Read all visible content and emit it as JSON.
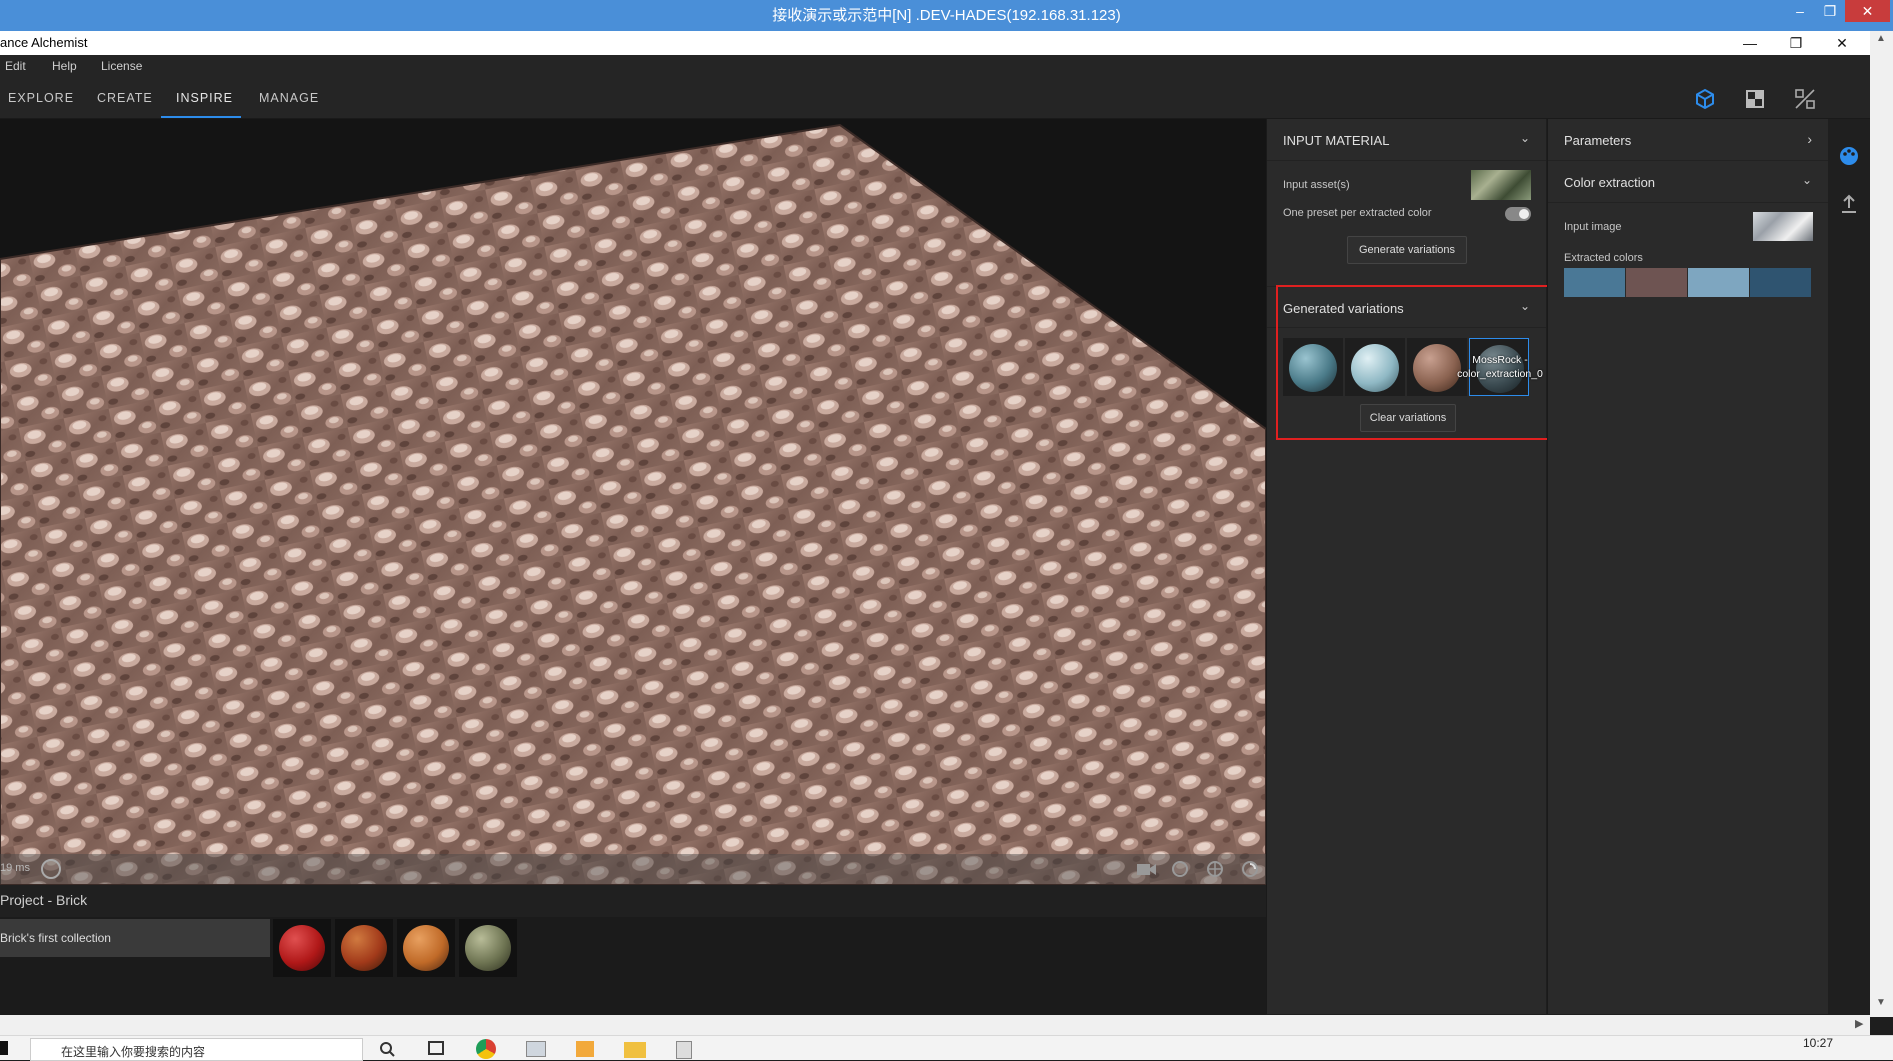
{
  "remote": {
    "title": "接收演示或示范中[N] .DEV-HADES(192.168.31.123)",
    "minimize": "–",
    "restore": "❐",
    "close": "✕"
  },
  "app": {
    "title": "ance Alchemist",
    "minimize": "—",
    "restore": "❐",
    "close": "✕"
  },
  "menu": {
    "items": [
      "Edit",
      "Help",
      "License"
    ]
  },
  "tabs": [
    {
      "label": "EXPLORE"
    },
    {
      "label": "CREATE"
    },
    {
      "label": "INSPIRE"
    },
    {
      "label": "MANAGE"
    }
  ],
  "active_tab": "INSPIRE",
  "toolbar_icons": [
    "cube-view-icon",
    "2d-view-icon",
    "split-view-icon"
  ],
  "viewport": {
    "render_time": "19 ms"
  },
  "project": {
    "title": "Project - Brick",
    "collection": "Brick's first collection",
    "materials": [
      {
        "color": "#b01818"
      },
      {
        "color": "#a23a1a"
      },
      {
        "color": "#c06a28"
      },
      {
        "color": "#6e7452"
      }
    ]
  },
  "input_material": {
    "header": "INPUT MATERIAL",
    "input_assets_label": "Input asset(s)",
    "one_preset_label": "One preset per extracted color",
    "one_preset_on": true,
    "generate_button": "Generate variations"
  },
  "generated": {
    "header": "Generated variations",
    "items": [
      {
        "color": "#4a7a88"
      },
      {
        "color": "#8fb8c4"
      },
      {
        "color": "#8a6250"
      },
      {
        "color": "#3c4c52",
        "label": "MossRock - color_extraction_0"
      }
    ],
    "clear_button": "Clear variations"
  },
  "parameters": {
    "header": "Parameters",
    "color_extraction_header": "Color extraction",
    "input_image_label": "Input image",
    "extracted_colors_label": "Extracted colors",
    "extracted_colors": [
      "#4a7896",
      "#6e5452",
      "#7ea6c0",
      "#2f5470"
    ]
  },
  "taskbar": {
    "search_placeholder": "在这里输入你要搜索的内容",
    "clock": "10:27"
  }
}
